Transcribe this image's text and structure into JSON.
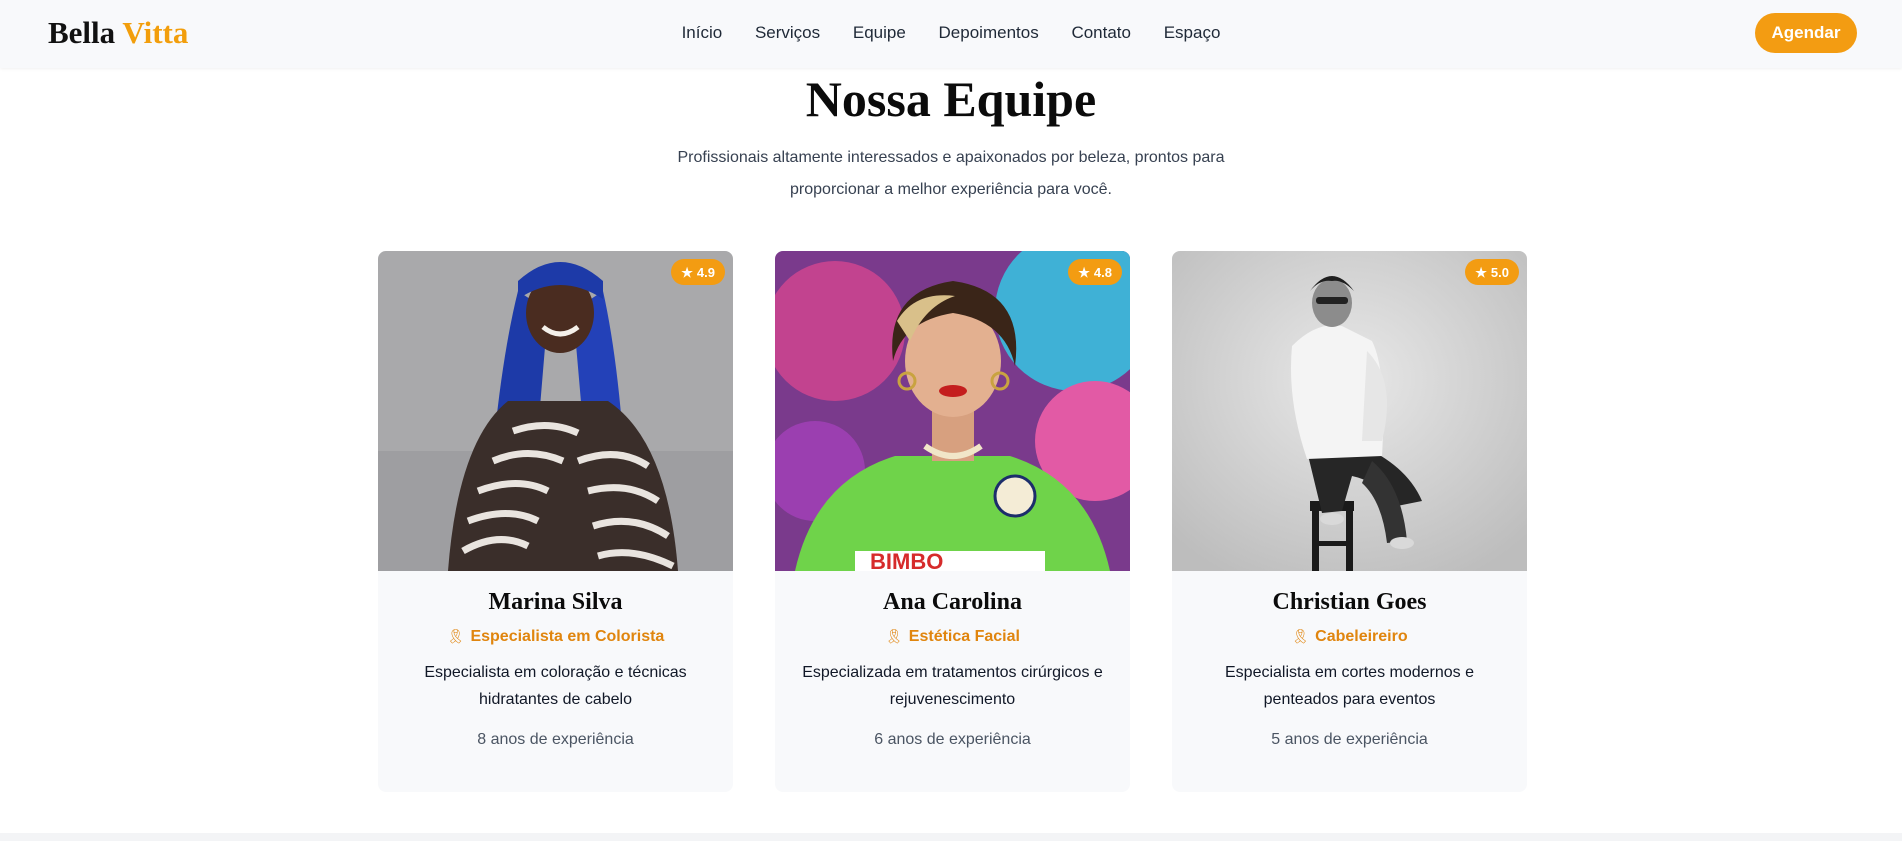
{
  "brand": {
    "word1": "Bella",
    "word2": "Vitta",
    "color_primary": "#111111",
    "color_accent": "#f29e0c"
  },
  "nav": {
    "items": [
      "Início",
      "Serviços",
      "Equipe",
      "Depoimentos",
      "Contato",
      "Espaço"
    ],
    "cta": "Agendar"
  },
  "section": {
    "title": "Nossa Equipe",
    "subtitle": "Profissionais altamente interessados e apaixonados por beleza, prontos para proporcionar a melhor experiência para você."
  },
  "team": [
    {
      "name": "Marina Silva",
      "role": "Especialista em Colorista",
      "description": "Especialista em coloração e técnicas hidratantes de cabelo",
      "experience": "8 anos de experiência",
      "rating": "4.9",
      "photo": "woman-blue-braids-zebra-top"
    },
    {
      "name": "Ana Carolina",
      "role": "Estética Facial",
      "description": "Especializada em tratamentos cirúrgicos e rejuvenescimento",
      "experience": "6 anos de experiência",
      "rating": "4.8",
      "photo": "woman-green-jersey-graffiti"
    },
    {
      "name": "Christian Goes",
      "role": "Cabeleireiro",
      "description": "Especialista em cortes modernos e penteados para eventos",
      "experience": "5 anos de experiência",
      "rating": "5.0",
      "photo": "man-sitting-stool-bw"
    }
  ],
  "icons": {
    "rating": "star-icon",
    "role": "award-icon"
  },
  "colors": {
    "accent": "#f39c12",
    "role_text": "#e0850e",
    "card_bg": "#f8f9fb"
  }
}
